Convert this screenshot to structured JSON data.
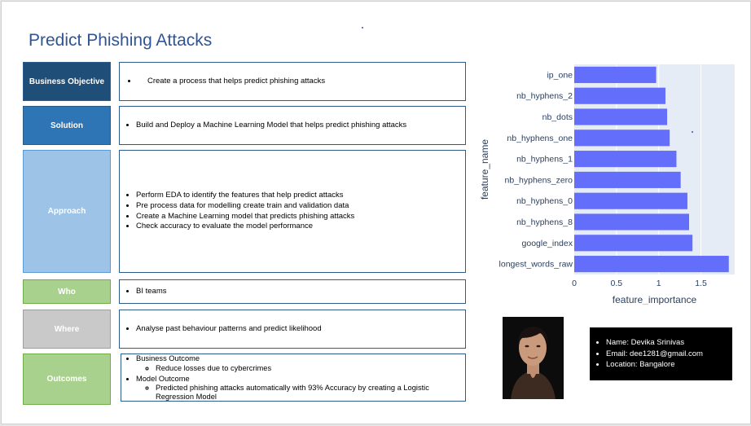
{
  "title": "Predict Phishing Attacks",
  "rows": {
    "objective": {
      "label": "Business Objective",
      "items": [
        "Create a process that helps predict phishing attacks"
      ]
    },
    "solution": {
      "label": "Solution",
      "items": [
        "Build and Deploy a Machine Learning Model that helps predict phishing attacks"
      ]
    },
    "approach": {
      "label": "Approach",
      "items": [
        "Perform EDA to identify the features that help predict attacks",
        "Pre process data for modelling create train and validation data",
        "Create a Machine Learning model that predicts phishing attacks",
        "Check accuracy to evaluate the model performance"
      ]
    },
    "who": {
      "label": "Who",
      "items": [
        "BI teams"
      ]
    },
    "where": {
      "label": "Where",
      "items": [
        "Analyse past behaviour patterns and predict likelihood"
      ]
    },
    "outcomes": {
      "label": "Outcomes",
      "business": "Business Outcome",
      "business_sub": "Reduce losses due to cybercrimes",
      "model": "Model Outcome",
      "model_sub": "Predicted phishing attacks automatically with 93% Accuracy by creating a Logistic Regression Model"
    }
  },
  "colors": {
    "objective": "#1f4e79",
    "solution": "#2e75b6",
    "approach": "#9dc3e6",
    "who": "#a9d18e",
    "where": "#c9c9c9",
    "outcomes": "#a9d18e",
    "bar": "#636efa",
    "plot_bg": "#e5ecf6"
  },
  "contact": {
    "name": "Name: Devika Srinivas",
    "email": "Email: dee1281@gmail.com",
    "location": "Location: Bangalore"
  },
  "chart_data": {
    "type": "bar",
    "orientation": "horizontal",
    "categories": [
      "ip_one",
      "nb_hyphens_2",
      "nb_dots",
      "nb_hyphens_one",
      "nb_hyphens_1",
      "nb_hyphens_zero",
      "nb_hyphens_0",
      "nb_hyphens_8",
      "google_index",
      "longest_words_raw"
    ],
    "values": [
      0.97,
      1.08,
      1.1,
      1.13,
      1.21,
      1.26,
      1.34,
      1.36,
      1.4,
      1.83
    ],
    "xlabel": "feature_importance",
    "ylabel": "feature_name",
    "xlim": [
      0,
      1.9
    ],
    "xticks": [
      "0",
      "0.5",
      "1",
      "1.5"
    ],
    "grid": true
  }
}
